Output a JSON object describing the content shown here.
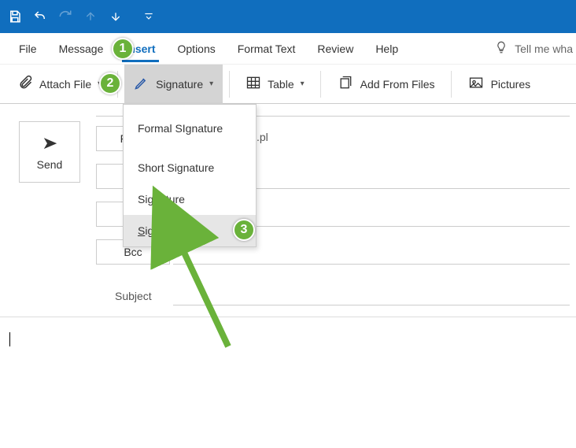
{
  "qat": {
    "more_glyph": "⌄"
  },
  "menubar": {
    "file": "File",
    "message": "Message",
    "insert": "Insert",
    "options": "Options",
    "format_text": "Format Text",
    "review": "Review",
    "help": "Help",
    "tellme": "Tell me wha"
  },
  "ribbon": {
    "attach_file": "Attach File",
    "signature": "Signature",
    "table": "Table",
    "add_from_files": "Add From Files",
    "pictures": "Pictures"
  },
  "signature_menu": {
    "items": [
      "Formal SIgnature",
      "Short Signature",
      "Signature",
      "Signatures..."
    ]
  },
  "compose": {
    "send": "Send",
    "from_label": "From",
    "from_value_suffix": ".pl",
    "bcc_label": "Bcc",
    "subject_label": "Subject"
  },
  "annotations": {
    "a1": "1",
    "a2": "2",
    "a3": "3"
  }
}
